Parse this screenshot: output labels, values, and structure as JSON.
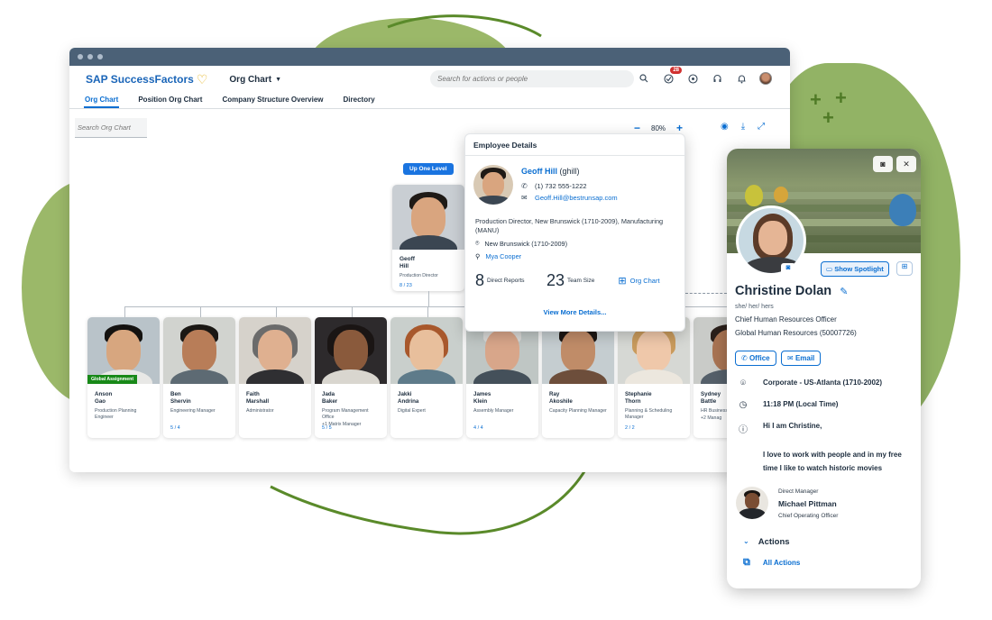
{
  "brand": {
    "name": "SAP SuccessFactors"
  },
  "shell": {
    "app_menu": "Org Chart",
    "search_placeholder": "Search for actions or people",
    "notification_badge": "28",
    "icons": [
      "search-icon",
      "todo-icon",
      "copilot-icon",
      "headset-icon",
      "bell-icon",
      "user-avatar"
    ]
  },
  "tabs": [
    {
      "label": "Org Chart",
      "active": true
    },
    {
      "label": "Position Org Chart",
      "active": false
    },
    {
      "label": "Company Structure Overview",
      "active": false
    },
    {
      "label": "Directory",
      "active": false
    }
  ],
  "toolbar": {
    "search_placeholder": "Search Org Chart",
    "zoom_level": "80%",
    "icons": [
      "zoom-out-icon",
      "zoom-in-icon",
      "visibility-icon",
      "download-icon",
      "fullscreen-icon"
    ]
  },
  "org": {
    "up_one_level": "Up One Level",
    "manager": {
      "first": "Geoff",
      "last": "Hill",
      "title": "Production Director",
      "count": "8 / 23"
    },
    "reports": [
      {
        "first": "Anson",
        "last": "Gao",
        "title": "Production Planning Engineer",
        "sub": "",
        "count": "",
        "badge": "Global Assignment"
      },
      {
        "first": "Ben",
        "last": "Shervin",
        "title": "Engineering Manager",
        "sub": "",
        "count": "5 / 4",
        "badge": ""
      },
      {
        "first": "Faith",
        "last": "Marshall",
        "title": "Administrator",
        "sub": "",
        "count": "",
        "badge": ""
      },
      {
        "first": "Jada",
        "last": "Baker",
        "title": "Program Management Office",
        "sub": "+1 Matrix Manager",
        "count": "5 / 5",
        "badge": ""
      },
      {
        "first": "Jakki",
        "last": "Andrina",
        "title": "Digital Expert",
        "sub": "",
        "count": "",
        "badge": ""
      },
      {
        "first": "James",
        "last": "Klein",
        "title": "Assembly Manager",
        "sub": "",
        "count": "4 / 4",
        "badge": ""
      },
      {
        "first": "Ray",
        "last": "Akoshile",
        "title": "Capacity Planning Manager",
        "sub": "",
        "count": "",
        "badge": ""
      },
      {
        "first": "Stephanie",
        "last": "Thorn",
        "title": "Planning & Scheduling Manager",
        "sub": "",
        "count": "2 / 2",
        "badge": ""
      },
      {
        "first": "Sydney",
        "last": "Battle",
        "title": "HR Business Partner USA",
        "sub": "+2 Manag",
        "count": "",
        "badge": ""
      }
    ]
  },
  "employee_details": {
    "header": "Employee Details",
    "name": "Geoff Hill",
    "user_id": "(ghill)",
    "phone": "(1) 732 555-1222",
    "email": "Geoff.Hill@bestrunsap.com",
    "position": "Production Director, New Brunswick (1710-2009), Manufacturing (MANU)",
    "location": "New Brunswick (1710-2009)",
    "manager": "Mya Cooper",
    "direct_reports_num": "8",
    "direct_reports_label": "Direct Reports",
    "team_size_num": "23",
    "team_size_label": "Team Size",
    "org_chart_link": "Org Chart",
    "view_more": "View More Details..."
  },
  "profile": {
    "name": "Christine Dolan",
    "pronouns": "she/ her/ hers",
    "title": "Chief Human Resources Officer",
    "department": "Global Human Resources (50007726)",
    "show_spotlight": "Show Spotlight",
    "office_button": "Office",
    "email_button": "Email",
    "location": "Corporate - US-Atlanta (1710-2002)",
    "local_time": "11:18 PM (Local Time)",
    "greeting": "Hi I am Christine,",
    "bio": "I love to work with people and in my free time I like to watch historic movies",
    "manager_label": "Direct Manager",
    "manager_name": "Michael Pittman",
    "manager_title": "Chief Operating Officer",
    "actions_header": "Actions",
    "all_actions": "All Actions"
  },
  "colors": {
    "brand_blue": "#0a6ed1",
    "accent_green": "#8aab4f",
    "badge_green": "#188918",
    "notification_red": "#d0302f",
    "titlebar": "#4b6177"
  }
}
